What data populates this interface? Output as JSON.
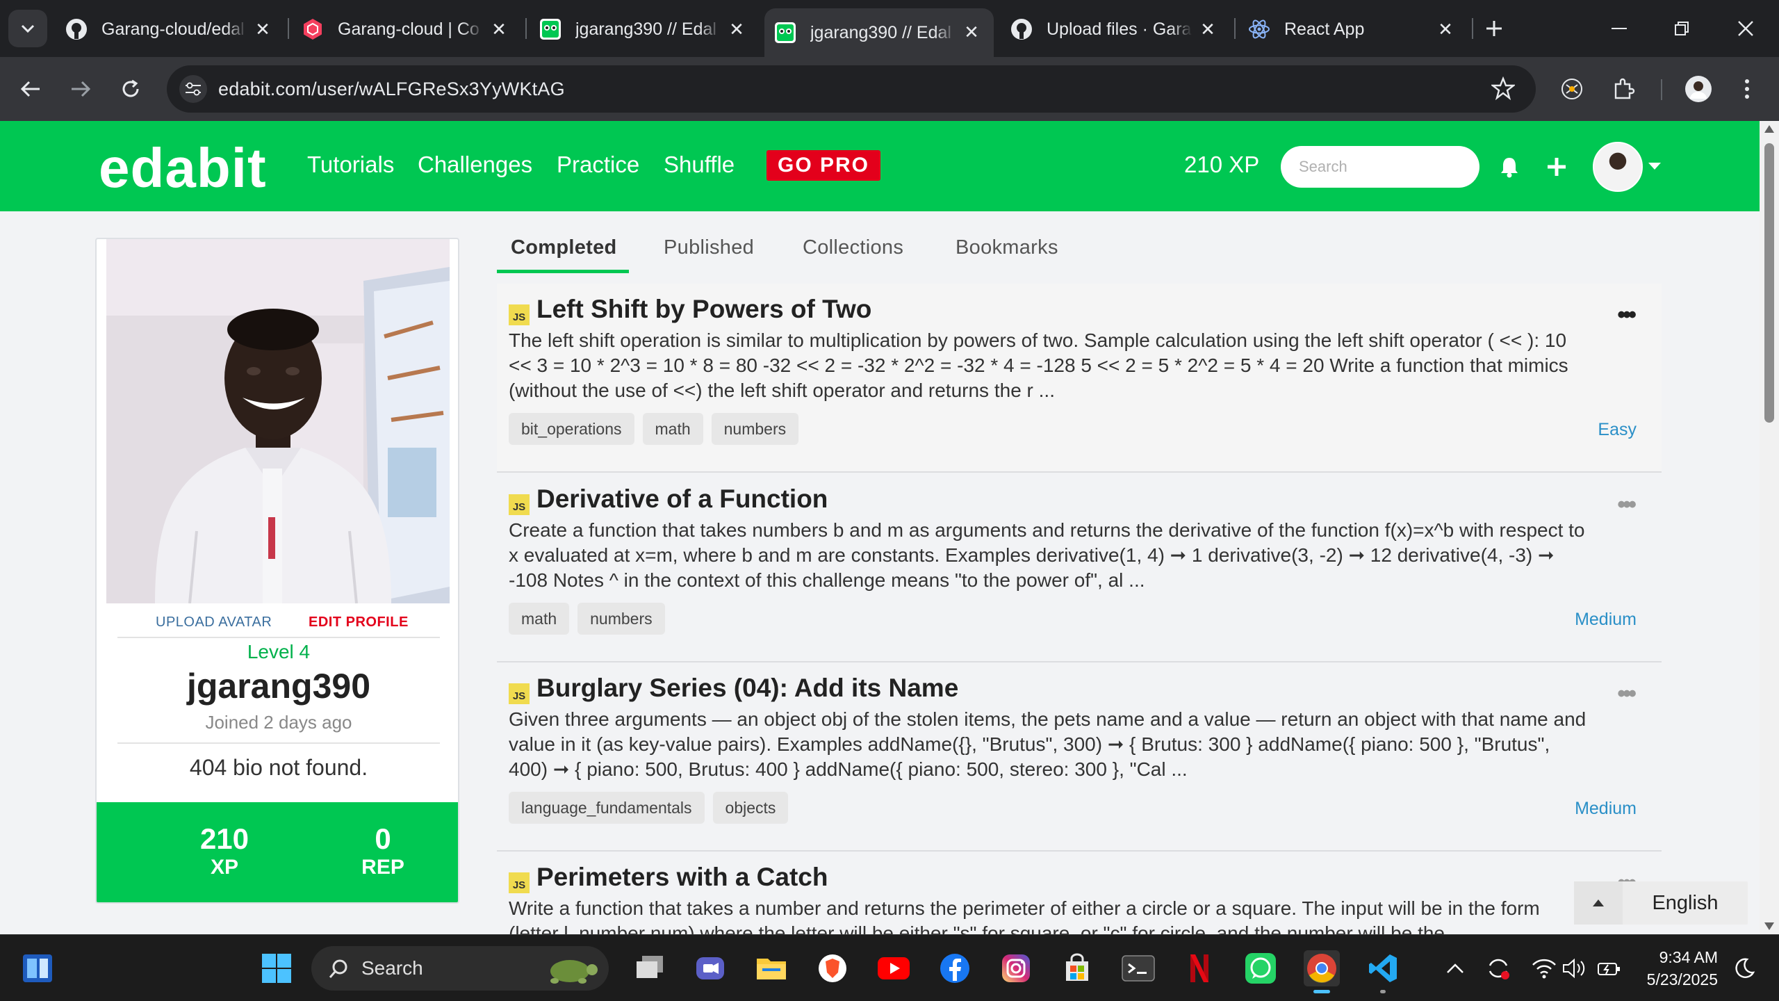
{
  "browser": {
    "tabs": [
      {
        "title": "Garang-cloud/edal",
        "icon": "github-icon"
      },
      {
        "title": "Garang-cloud | Co",
        "icon": "codepen-icon"
      },
      {
        "title": "jgarang390 // Edal",
        "icon": "edabit-icon"
      },
      {
        "title": "jgarang390 // Edal",
        "icon": "edabit-icon",
        "active": true
      },
      {
        "title": "Upload files · Garan",
        "icon": "github-icon"
      },
      {
        "title": "React App",
        "icon": "react-icon"
      }
    ],
    "url": "edabit.com/user/wALFGReSx3YyWKtAG"
  },
  "site": {
    "logo": "edabit",
    "nav": [
      "Tutorials",
      "Challenges",
      "Practice",
      "Shuffle"
    ],
    "gopro": "GO PRO",
    "xp": "210 XP",
    "search_placeholder": "Search",
    "brand_color": "#00c752"
  },
  "profile": {
    "upload_avatar": "UPLOAD AVATAR",
    "edit_profile": "EDIT PROFILE",
    "level": "Level 4",
    "username": "jgarang390",
    "joined": "Joined 2 days ago",
    "bio": "404 bio not found.",
    "xp_value": "210",
    "xp_label": "XP",
    "rep_value": "0",
    "rep_label": "REP"
  },
  "tabs": [
    "Completed",
    "Published",
    "Collections",
    "Bookmarks"
  ],
  "challenges": [
    {
      "lang": "JS",
      "title": "Left Shift by Powers of Two",
      "description": "The left shift operation is similar to multiplication by powers of two. Sample calculation using the left shift operator ( << ): 10 << 3 = 10 * 2^3 = 10 * 8 = 80 -32 << 2 = -32 * 2^2 = -32 * 4 = -128 5 << 2 = 5 * 2^2 = 5 * 4 = 20 Write a function that mimics (without the use of <<) the left shift operator and returns the r ...",
      "tags": [
        "bit_operations",
        "math",
        "numbers"
      ],
      "difficulty": "Easy"
    },
    {
      "lang": "JS",
      "title": "Derivative of a Function",
      "description": "Create a function that takes numbers b and m as arguments and returns the derivative of the function f(x)=x^b with respect to x evaluated at x=m, where b and m are constants. Examples derivative(1, 4) ➞ 1 derivative(3, -2) ➞ 12 derivative(4, -3) ➞ -108 Notes ^ in the context of this challenge means \"to the power of\", al ...",
      "tags": [
        "math",
        "numbers"
      ],
      "difficulty": "Medium"
    },
    {
      "lang": "JS",
      "title": "Burglary Series (04): Add its Name",
      "description": "Given three arguments — an object obj of the stolen items, the pets name and a value — return an object with that name and value in it (as key-value pairs). Examples addName({}, \"Brutus\", 300) ➞ { Brutus: 300 } addName({ piano: 500 }, \"Brutus\", 400) ➞ { piano: 500, Brutus: 400 } addName({ piano: 500, stereo: 300 }, \"Cal ...",
      "tags": [
        "language_fundamentals",
        "objects"
      ],
      "difficulty": "Medium"
    },
    {
      "lang": "JS",
      "title": "Perimeters with a Catch",
      "description": "Write a function that takes a number and returns the perimeter of either a circle or a square. The input will be in the form (letter l, number num) where the letter will be either \"s\" for square, or \"c\" for circle, and the number will be the",
      "tags": [],
      "difficulty": ""
    }
  ],
  "language_widget": "English",
  "taskbar": {
    "search": "Search",
    "time": "9:34 AM",
    "date": "5/23/2025"
  }
}
